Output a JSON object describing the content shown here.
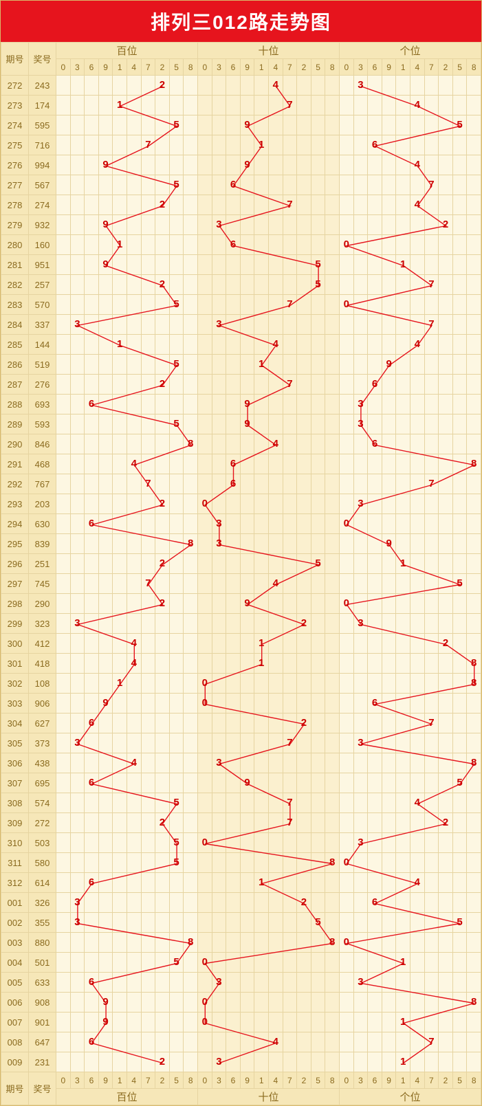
{
  "title": "排列三012路走势图",
  "columns": {
    "period": "期号",
    "number": "奖号",
    "groups": [
      "百位",
      "十位",
      "个位"
    ],
    "digits": [
      "0",
      "3",
      "6",
      "9",
      "1",
      "4",
      "7",
      "2",
      "5",
      "8"
    ]
  },
  "chart_data": {
    "type": "line",
    "title": "排列三012路走势图",
    "digit_order": [
      0,
      3,
      6,
      9,
      1,
      4,
      7,
      2,
      5,
      8
    ],
    "series": [
      {
        "name": "百位",
        "values": [
          2,
          1,
          5,
          7,
          9,
          5,
          2,
          9,
          1,
          9,
          2,
          5,
          3,
          1,
          5,
          2,
          6,
          5,
          8,
          4,
          7,
          2,
          6,
          8,
          2,
          7,
          2,
          3,
          4,
          4,
          1,
          9,
          6,
          3,
          4,
          6,
          5,
          2,
          5,
          5,
          6,
          3,
          3,
          8,
          5,
          6,
          9,
          9,
          6,
          2
        ]
      },
      {
        "name": "十位",
        "values": [
          4,
          7,
          9,
          1,
          9,
          6,
          7,
          3,
          6,
          5,
          5,
          7,
          3,
          4,
          1,
          7,
          9,
          9,
          4,
          6,
          6,
          0,
          3,
          3,
          5,
          4,
          9,
          2,
          1,
          1,
          0,
          0,
          2,
          7,
          3,
          9,
          7,
          7,
          0,
          8,
          1,
          2,
          5,
          8,
          0,
          3,
          0,
          0,
          4,
          3
        ]
      },
      {
        "name": "个位",
        "values": [
          3,
          4,
          5,
          6,
          4,
          7,
          4,
          2,
          0,
          1,
          7,
          0,
          7,
          4,
          9,
          6,
          3,
          3,
          6,
          8,
          7,
          3,
          0,
          9,
          1,
          5,
          0,
          3,
          2,
          8,
          8,
          6,
          7,
          3,
          8,
          5,
          4,
          2,
          3,
          0,
          4,
          6,
          5,
          0,
          1,
          3,
          8,
          1,
          7,
          1
        ]
      }
    ],
    "periods": [
      "272",
      "273",
      "274",
      "275",
      "276",
      "277",
      "278",
      "279",
      "280",
      "281",
      "282",
      "283",
      "284",
      "285",
      "286",
      "287",
      "288",
      "289",
      "290",
      "291",
      "292",
      "293",
      "294",
      "295",
      "296",
      "297",
      "298",
      "299",
      "300",
      "301",
      "302",
      "303",
      "304",
      "305",
      "306",
      "307",
      "308",
      "309",
      "310",
      "311",
      "312",
      "001",
      "002",
      "003",
      "004",
      "005",
      "006",
      "007",
      "008",
      "009"
    ],
    "numbers": [
      "243",
      "174",
      "595",
      "716",
      "994",
      "567",
      "274",
      "932",
      "160",
      "951",
      "257",
      "570",
      "337",
      "144",
      "519",
      "276",
      "693",
      "593",
      "846",
      "468",
      "767",
      "203",
      "630",
      "839",
      "251",
      "745",
      "290",
      "323",
      "412",
      "418",
      "108",
      "906",
      "627",
      "373",
      "438",
      "695",
      "574",
      "272",
      "503",
      "580",
      "614",
      "326",
      "355",
      "880",
      "501",
      "633",
      "908",
      "901",
      "647",
      "231"
    ]
  }
}
